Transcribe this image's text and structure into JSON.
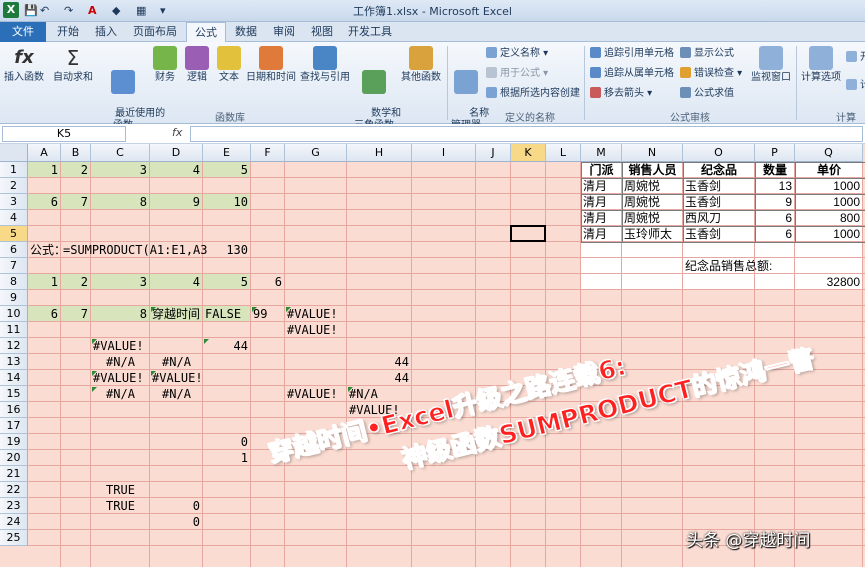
{
  "window": {
    "title": "工作簿1.xlsx - Microsoft Excel",
    "app_icon": "X"
  },
  "tabs": [
    {
      "label": "文件"
    },
    {
      "label": "开始"
    },
    {
      "label": "插入"
    },
    {
      "label": "页面布局"
    },
    {
      "label": "公式"
    },
    {
      "label": "数据"
    },
    {
      "label": "审阅"
    },
    {
      "label": "视图"
    },
    {
      "label": "开发工具"
    }
  ],
  "ribbon": {
    "insert_function": "插入函数",
    "autosum": "自动求和",
    "recent": "最近使用的\n函数",
    "financial": "财务",
    "logical": "逻辑",
    "text": "文本",
    "datetime": "日期和时间",
    "lookup": "查找与引用",
    "math": "数学和\n三角函数",
    "other": "其他函数",
    "group_library": "函数库",
    "name_manager": "名称\n管理器",
    "define_name": "定义名称",
    "use_in_formula": "用于公式",
    "create_from_selection": "根据所选内容创建",
    "group_names": "定义的名称",
    "trace_precedents": "追踪引用单元格",
    "trace_dependents": "追踪从属单元格",
    "remove_arrows": "移去箭头",
    "show_formulas": "显示公式",
    "error_checking": "错误检查",
    "evaluate_formula": "公式求值",
    "group_audit": "公式审核",
    "watch_window": "监视窗口",
    "calc_options": "计算选项",
    "group_calc": "计算",
    "calc_extra_1": "开",
    "calc_extra_2": "计"
  },
  "formula_bar": {
    "name_box": "K5",
    "fx": "fx",
    "formula": ""
  },
  "columns": [
    "A",
    "B",
    "C",
    "D",
    "E",
    "F",
    "G",
    "H",
    "I",
    "J",
    "K",
    "L",
    "M",
    "N",
    "O",
    "P",
    "Q"
  ],
  "rows": [
    "1",
    "2",
    "3",
    "4",
    "5",
    "6",
    "7",
    "8",
    "9",
    "10",
    "11",
    "12",
    "13",
    "14",
    "15",
    "16",
    "17",
    "19",
    "20",
    "21",
    "22",
    "23",
    "24",
    "25"
  ],
  "cells": {
    "A1": "1",
    "B1": "2",
    "C1": "3",
    "D1": "4",
    "E1": "5",
    "A3": "6",
    "B3": "7",
    "C3": "8",
    "D3": "9",
    "E3": "10",
    "A6": "公式：",
    "B6": "=SUMPRODUCT(A1:E1,A3",
    "E6": "130",
    "A8": "1",
    "B8": "2",
    "C8": "3",
    "D8": "4",
    "E8": "5",
    "F8": "6",
    "A10": "6",
    "B10": "7",
    "C10": "8",
    "D10": "穿越时间",
    "E10": "FALSE",
    "F10": "99",
    "G10": "#VALUE!",
    "G11": "#VALUE!",
    "C12": "#VALUE!",
    "E12": "44",
    "C13": "#N/A",
    "D13": "#N/A",
    "H13": "44",
    "C14": "#VALUE!",
    "D14": "#VALUE!",
    "H14": "44",
    "C15": "#N/A",
    "D15": "#N/A",
    "G15": "#VALUE!",
    "H15": "#N/A",
    "H16": "#VALUE!",
    "E19": "0",
    "E20": "1",
    "F20": "0",
    "C22": "TRUE",
    "C23": "TRUE",
    "D23": "0",
    "D24": "0"
  },
  "table": {
    "headers": [
      "门派",
      "销售人员",
      "纪念品",
      "数量",
      "单价"
    ],
    "rows": [
      [
        "清月",
        "周婉悦",
        "玉香剑",
        "13",
        "1000"
      ],
      [
        "清月",
        "周婉悦",
        "玉香剑",
        "9",
        "1000"
      ],
      [
        "清月",
        "周婉悦",
        "西风刀",
        "6",
        "800"
      ],
      [
        "清月",
        "玉玲师太",
        "玉香剑",
        "6",
        "1000"
      ]
    ],
    "total_label": "纪念品销售总额:",
    "total_value": "32800"
  },
  "overlay": {
    "line1": "穿越时间•Excel升级之路连载6:",
    "line2": "神级函数SUMPRODUCT的惊鸿一瞥",
    "watermark": "头条 @穿越时间"
  },
  "colors": {
    "grid_fill": "#fadcd2",
    "green_fill": "#d7e4bc",
    "table_fill": "#ffffff",
    "overlay_text": "#ff2020",
    "file_tab": "#2a6fb7"
  }
}
